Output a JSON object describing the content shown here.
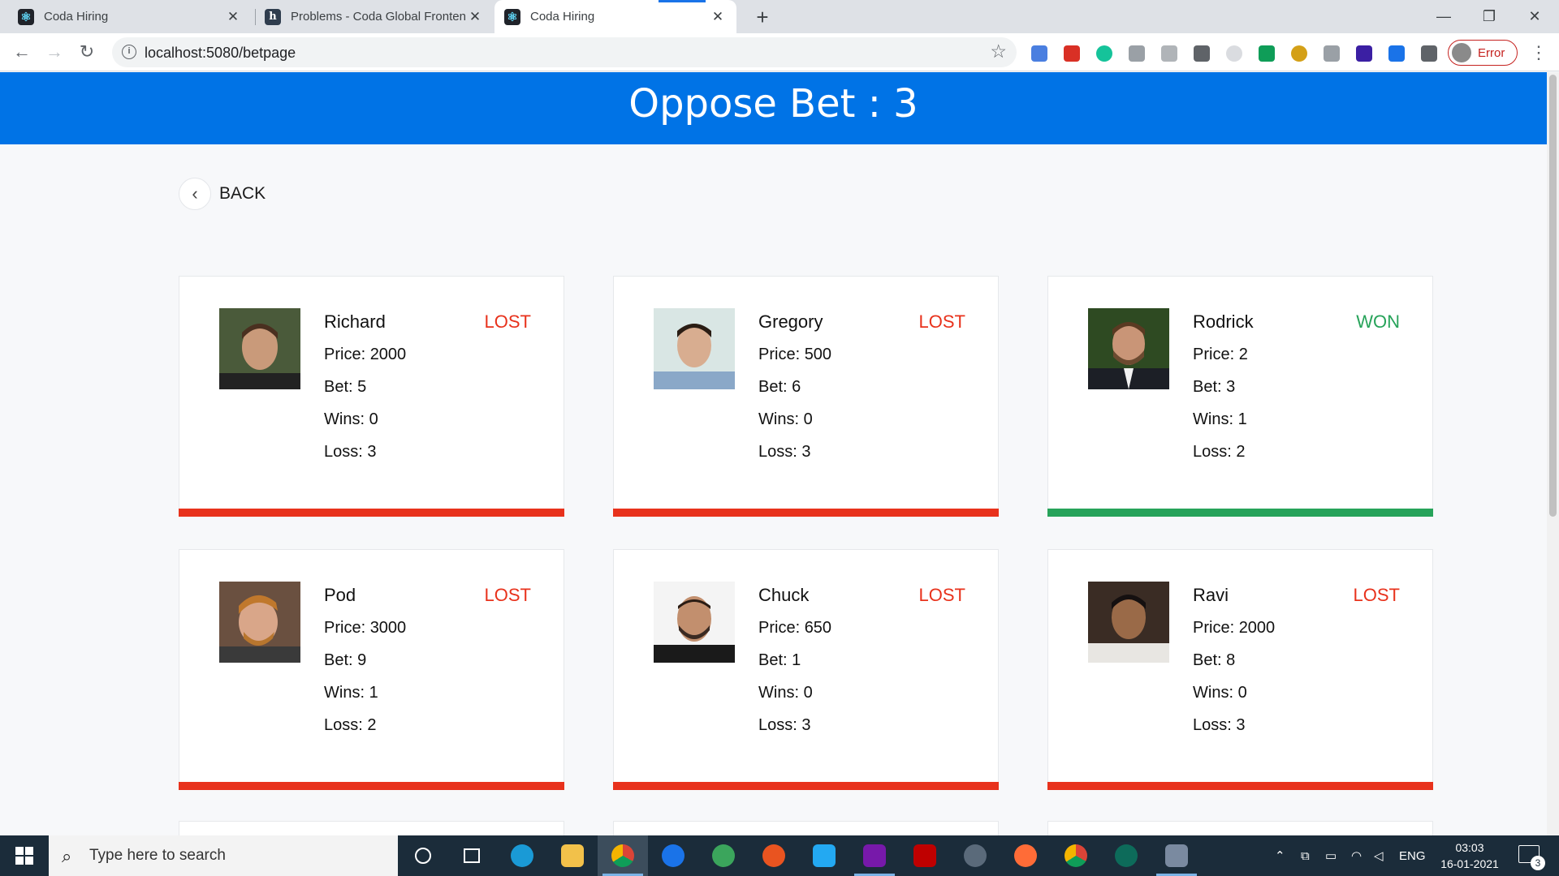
{
  "browser": {
    "tabs": [
      {
        "title": "Coda Hiring",
        "icon": "react-icon"
      },
      {
        "title": "Problems - Coda Global Frontend",
        "icon": "hackerearth-icon"
      },
      {
        "title": "Coda Hiring",
        "icon": "react-icon"
      }
    ],
    "active_tab": 2,
    "url": "localhost:5080/betpage",
    "profile_label": "Error"
  },
  "page": {
    "title": "Oppose Bet : 3",
    "back_label": "BACK"
  },
  "labels": {
    "price": "Price: ",
    "bet": "Bet: ",
    "wins": "Wins: ",
    "loss": "Loss: "
  },
  "colors": {
    "header_bg": "#0073e6",
    "lost": "#e8321c",
    "won": "#27a35a"
  },
  "players": [
    {
      "name": "Richard",
      "status": "LOST",
      "price": "2000",
      "bet": "5",
      "wins": "0",
      "loss": "3"
    },
    {
      "name": "Gregory",
      "status": "LOST",
      "price": "500",
      "bet": "6",
      "wins": "0",
      "loss": "3"
    },
    {
      "name": "Rodrick",
      "status": "WON",
      "price": "2",
      "bet": "3",
      "wins": "1",
      "loss": "2"
    },
    {
      "name": "Pod",
      "status": "LOST",
      "price": "3000",
      "bet": "9",
      "wins": "1",
      "loss": "2"
    },
    {
      "name": "Chuck",
      "status": "LOST",
      "price": "650",
      "bet": "1",
      "wins": "0",
      "loss": "3"
    },
    {
      "name": "Ravi",
      "status": "LOST",
      "price": "2000",
      "bet": "8",
      "wins": "0",
      "loss": "3"
    }
  ],
  "taskbar": {
    "search_placeholder": "Type here to search",
    "language": "ENG",
    "time": "03:03",
    "date": "16-01-2021",
    "notification_count": "3"
  }
}
